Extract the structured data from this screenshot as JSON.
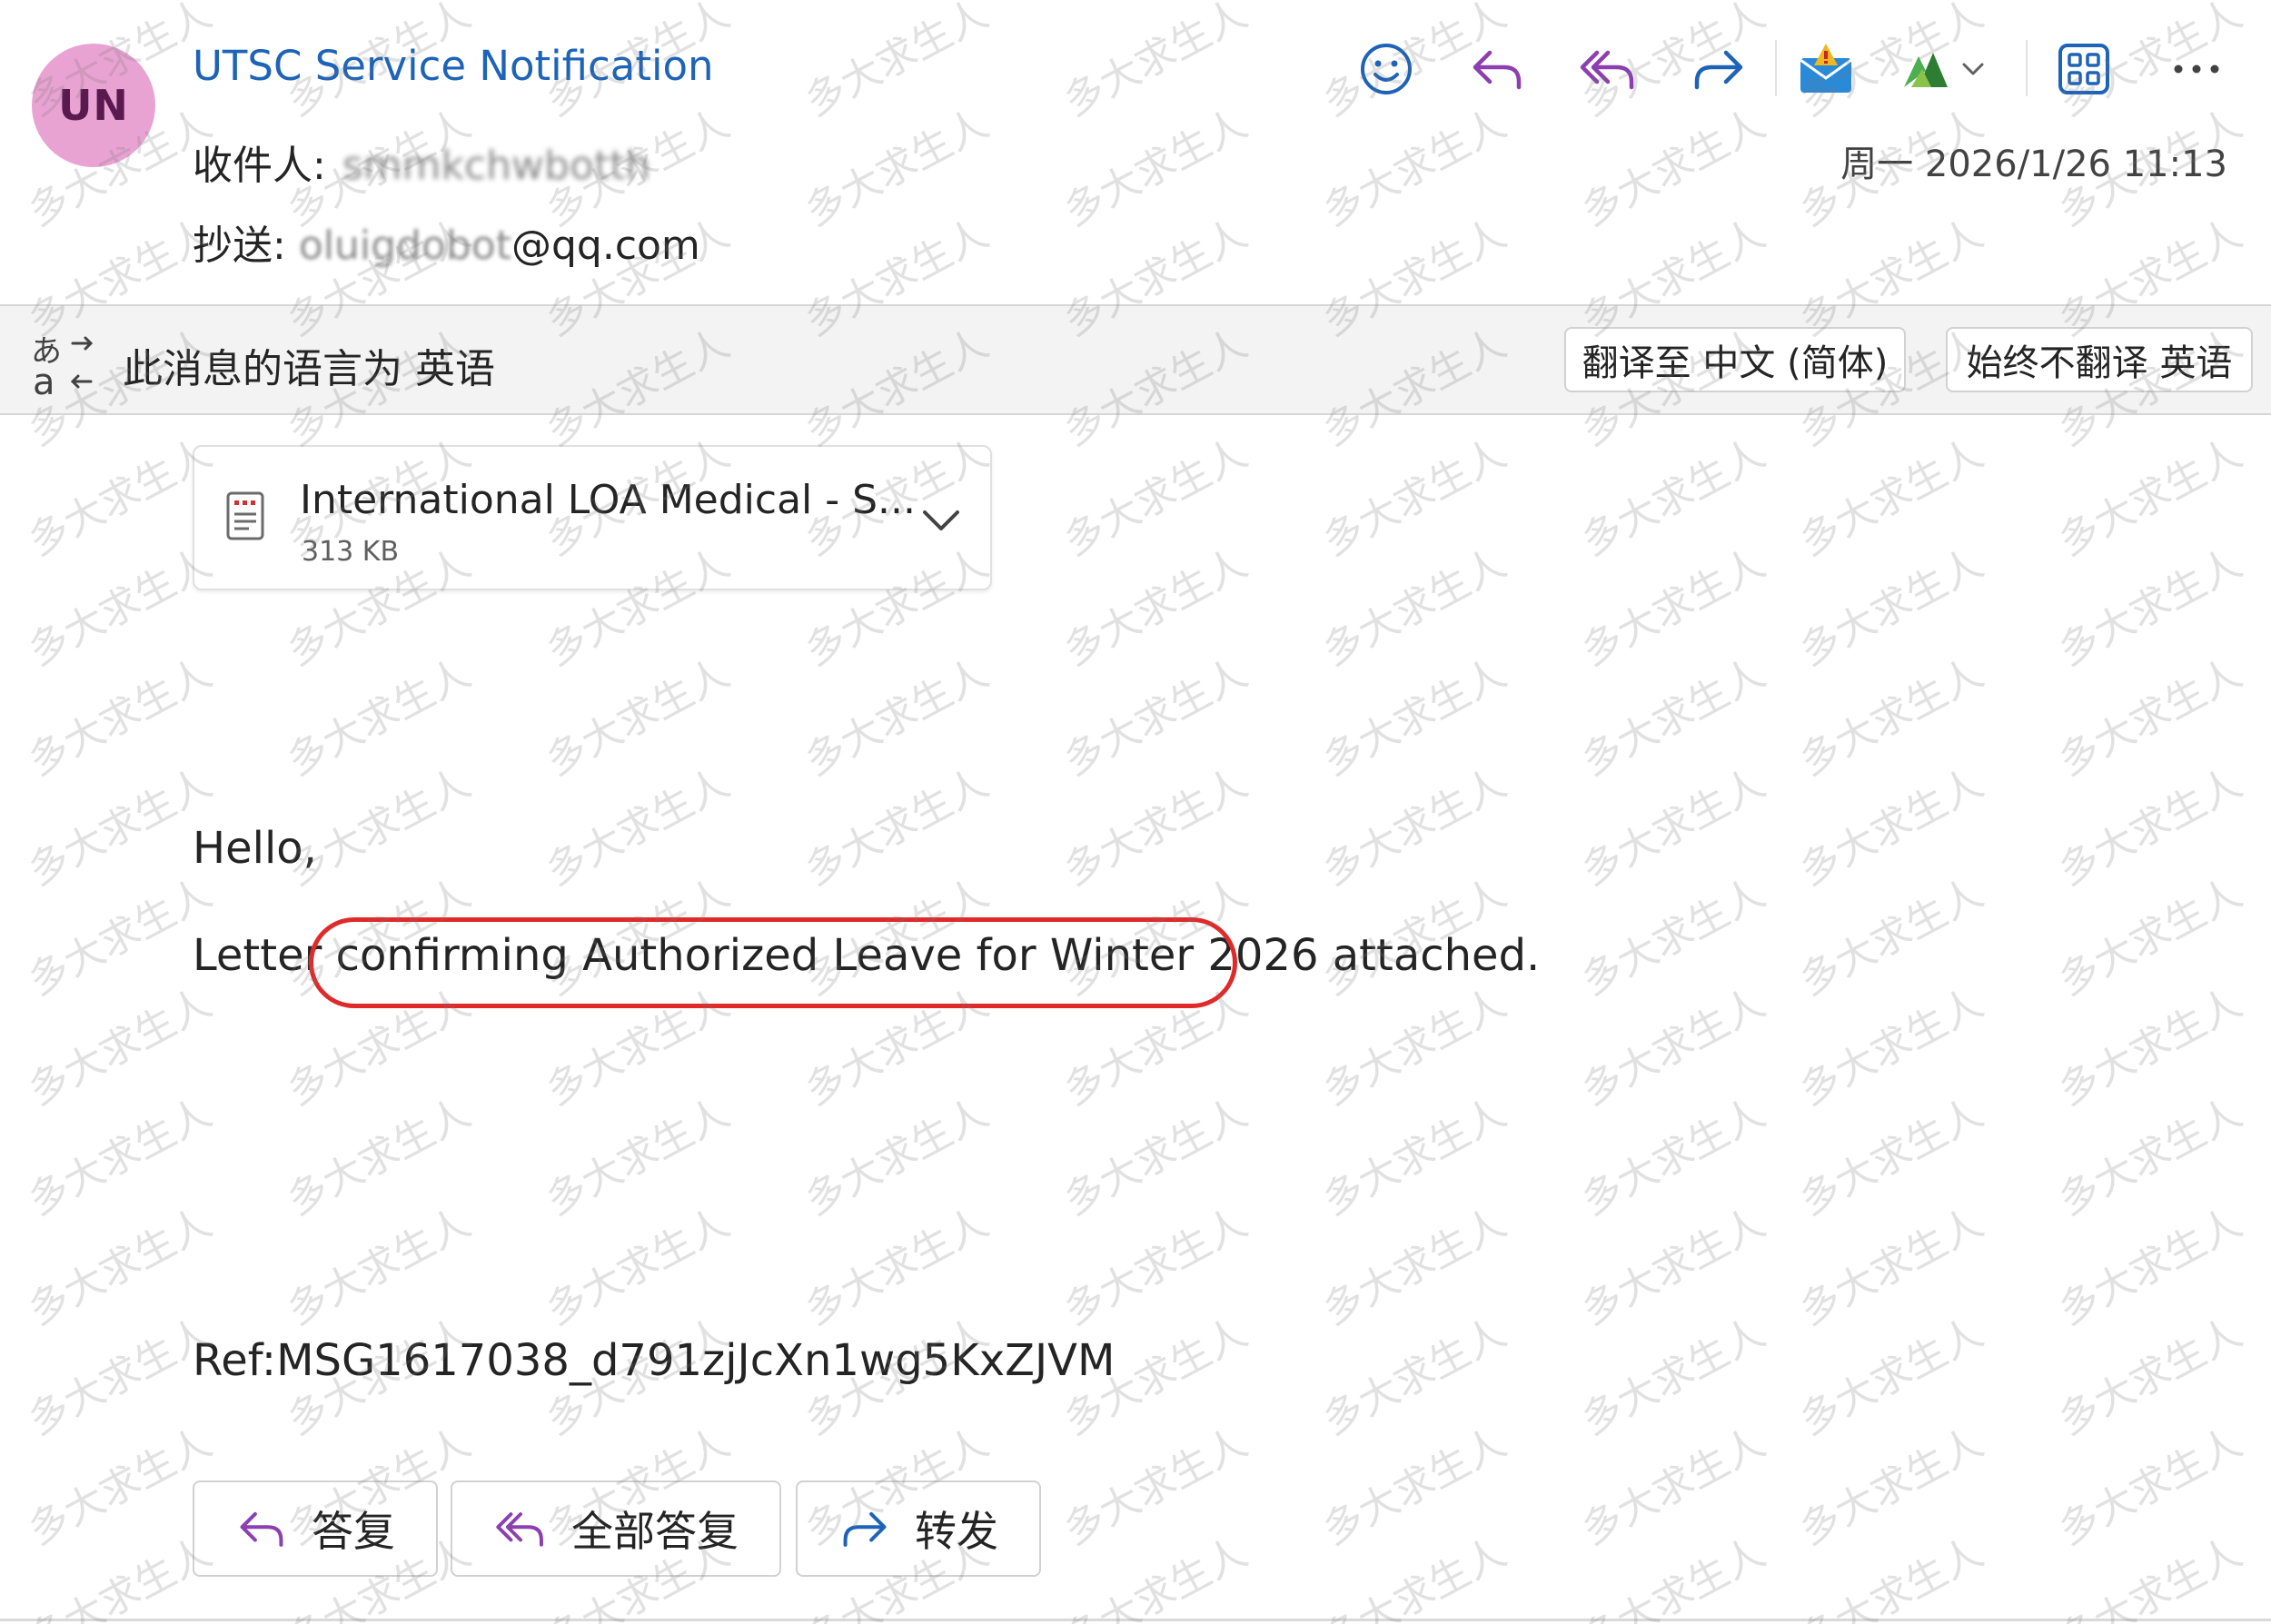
{
  "header": {
    "avatar_initials": "UN",
    "avatar_color": "#e8a3d3",
    "sender": "UTSC Service Notification",
    "to_label": "收件人:",
    "to_value": "smmkchwbotth",
    "cc_label": "抄送:",
    "cc_value_obscured": "oluigdobot",
    "cc_value_domain": "@qq.com",
    "date": "周一 2026/1/26 11:13"
  },
  "toolbar": {
    "icons": [
      "emoji-icon",
      "reply-icon",
      "reply-all-icon",
      "forward-icon",
      "report-mail-icon",
      "addin-icon",
      "chevron-down-icon",
      "apps-grid-icon",
      "more-icon"
    ]
  },
  "translate_bar": {
    "message": "此消息的语言为 英语",
    "translate_button": "翻译至 中文 (简体)",
    "never_button": "始终不翻译 英语"
  },
  "attachment": {
    "name": "International LOA Medical - S...",
    "size": "313 KB"
  },
  "body": {
    "greeting": "Hello,",
    "line_prefix": "Letter ",
    "line_highlight": "confirming Authorized Leave for Winter 2026",
    "line_suffix": " attached.",
    "ref": "Ref:MSG1617038_d791zjJcXn1wg5KxZJVM"
  },
  "actions": {
    "reply": "答复",
    "reply_all": "全部答复",
    "forward": "转发"
  },
  "watermark": "多大求生人",
  "colors": {
    "accent": "#1d63b8",
    "reply_purple": "#8b3fb0",
    "forward_blue": "#1d63b8",
    "highlight_red": "#e02a2a"
  }
}
